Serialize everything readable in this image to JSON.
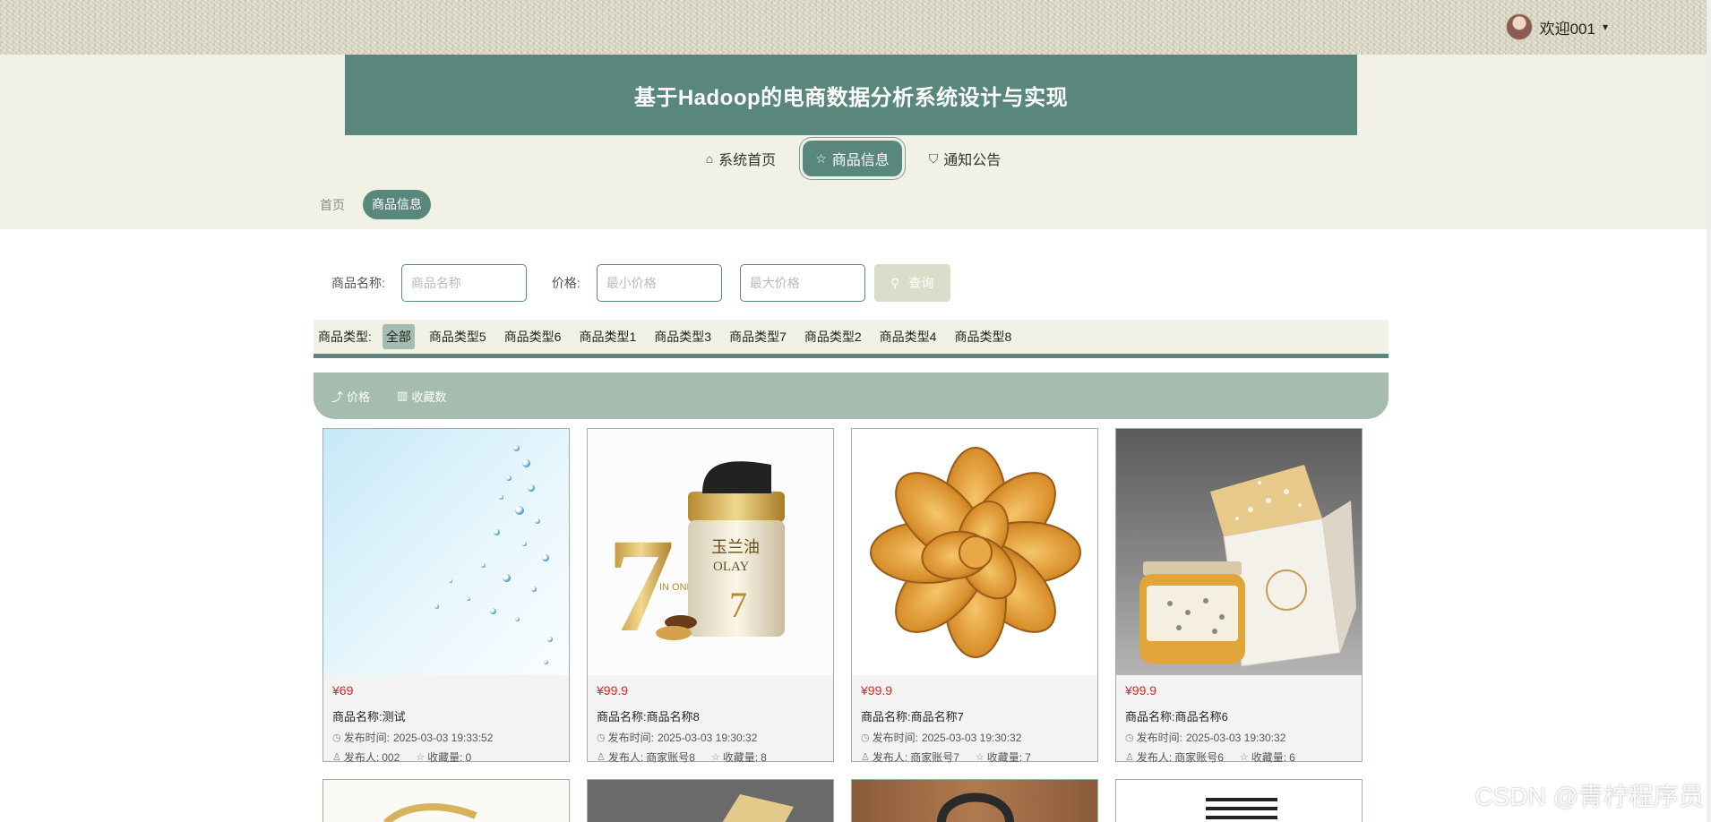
{
  "header": {
    "site_title": "基于Hadoop的电商数据分析系统设计与实现",
    "welcome": "欢迎001",
    "caret": "▾"
  },
  "nav": {
    "items": [
      {
        "label": "系统首页",
        "icon": "home-icon",
        "glyph": "⌂"
      },
      {
        "label": "商品信息",
        "icon": "star-icon",
        "glyph": "☆"
      },
      {
        "label": "通知公告",
        "icon": "bag-icon",
        "glyph": "⛉"
      }
    ]
  },
  "breadcrumb": {
    "home": "首页",
    "current": "商品信息"
  },
  "search": {
    "name_label": "商品名称:",
    "name_placeholder": "商品名称",
    "price_label": "价格:",
    "min_placeholder": "最小价格",
    "max_placeholder": "最大价格",
    "button_label": "查询",
    "button_glyph": "⚲"
  },
  "types": {
    "label": "商品类型:",
    "items": [
      "全部",
      "商品类型5",
      "商品类型6",
      "商品类型1",
      "商品类型3",
      "商品类型7",
      "商品类型2",
      "商品类型4",
      "商品类型8"
    ]
  },
  "sort": {
    "price": "价格",
    "favorites": "收藏数",
    "price_glyph": "⤴",
    "favorites_glyph": "▥"
  },
  "meta_labels": {
    "time": "发布时间:",
    "publisher": "发布人:",
    "favorites": "收藏量:",
    "clock_glyph": "◷",
    "person_glyph": "♙",
    "star_glyph": "☆"
  },
  "products": [
    {
      "price": "¥69",
      "name": "商品名称:测试",
      "time": "2025-03-03 19:33:52",
      "publisher": "002",
      "favorites": "0"
    },
    {
      "price": "¥99.9",
      "name": "商品名称:商品名称8",
      "time": "2025-03-03 19:30:32",
      "publisher": "商家账号8",
      "favorites": "8"
    },
    {
      "price": "¥99.9",
      "name": "商品名称:商品名称7",
      "time": "2025-03-03 19:30:32",
      "publisher": "商家账号7",
      "favorites": "7"
    },
    {
      "price": "¥99.9",
      "name": "商品名称:商品名称6",
      "time": "2025-03-03 19:30:32",
      "publisher": "商家账号6",
      "favorites": "6"
    }
  ],
  "cream_label": {
    "brand_cn": "玉兰油",
    "brand_en": "OLAY",
    "number": "7",
    "in_one": "IN ONE"
  },
  "watermark": "CSDN @青柠程序员"
}
